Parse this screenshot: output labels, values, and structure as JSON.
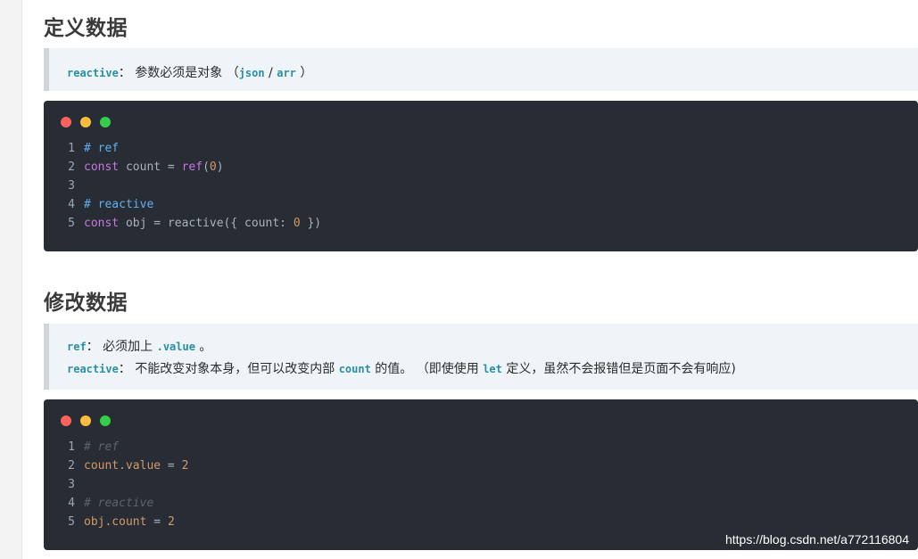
{
  "section1": {
    "title": "定义数据",
    "note": {
      "code1": "reactive",
      "text1": "： 参数必须是对象 （",
      "code2": "json",
      "sep": " / ",
      "code3": "arr",
      "text2": " ）"
    },
    "code": {
      "lines": [
        {
          "n": "1",
          "tokens": [
            {
              "t": "# ref",
              "k": "comment"
            }
          ]
        },
        {
          "n": "2",
          "tokens": [
            {
              "t": "const",
              "k": "keyword"
            },
            {
              "t": " count = ",
              "k": "plain"
            },
            {
              "t": "ref",
              "k": "func"
            },
            {
              "t": "(",
              "k": "plain"
            },
            {
              "t": "0",
              "k": "num"
            },
            {
              "t": ")",
              "k": "plain"
            }
          ]
        },
        {
          "n": "3",
          "tokens": []
        },
        {
          "n": "4",
          "tokens": [
            {
              "t": "# reactive",
              "k": "comment"
            }
          ]
        },
        {
          "n": "5",
          "tokens": [
            {
              "t": "const",
              "k": "keyword"
            },
            {
              "t": " obj = reactive({ count: ",
              "k": "plain"
            },
            {
              "t": "0",
              "k": "num"
            },
            {
              "t": " })",
              "k": "plain"
            }
          ]
        }
      ]
    }
  },
  "section2": {
    "title": "修改数据",
    "note": {
      "line1": {
        "code1": "ref",
        "text1": "： 必须加上 ",
        "code2": ".value",
        "text2": " 。"
      },
      "line2": {
        "code1": "reactive",
        "text1": "： 不能改变对象本身，但可以改变内部 ",
        "code2": "count",
        "text2": " 的值。 （即使使用 ",
        "code3": "let",
        "text3": " 定义，虽然不会报错但是页面不会有响应)"
      }
    },
    "code": {
      "lines": [
        {
          "n": "1",
          "tokens": [
            {
              "t": "# ref",
              "k": "comment-muted"
            }
          ]
        },
        {
          "n": "2",
          "tokens": [
            {
              "t": "count.value",
              "k": "prop"
            },
            {
              "t": " = ",
              "k": "plain"
            },
            {
              "t": "2",
              "k": "num"
            }
          ]
        },
        {
          "n": "3",
          "tokens": []
        },
        {
          "n": "4",
          "tokens": [
            {
              "t": "# reactive",
              "k": "comment-muted"
            }
          ]
        },
        {
          "n": "5",
          "tokens": [
            {
              "t": "obj.count",
              "k": "prop"
            },
            {
              "t": " = ",
              "k": "plain"
            },
            {
              "t": "2",
              "k": "num"
            }
          ]
        }
      ]
    }
  },
  "watermark": "https://blog.csdn.net/a772116804",
  "colors": {
    "code_bg": "#282c34",
    "note_bg": "#eef4f8",
    "inline_code": "#2a8fa5",
    "dot_red": "#fc625d",
    "dot_yellow": "#fdbc40",
    "dot_green": "#35cd4b"
  }
}
